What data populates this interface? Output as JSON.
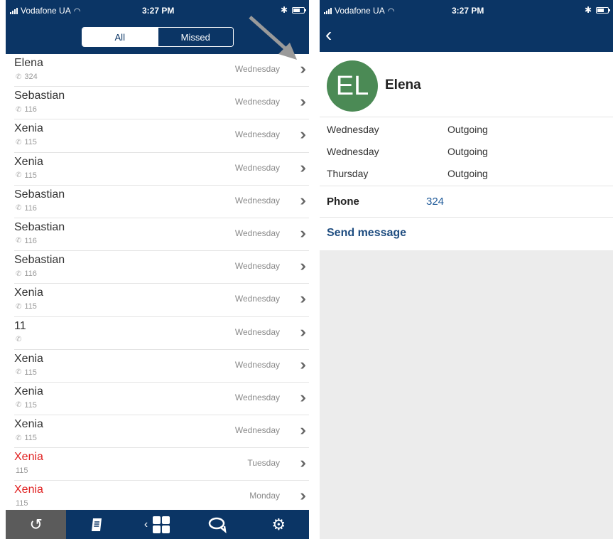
{
  "left": {
    "status": {
      "carrier": "Vodafone UA",
      "time": "3:27 PM"
    },
    "segments": {
      "all": "All",
      "missed": "Missed"
    },
    "calls": [
      {
        "name": "Elena",
        "number": "324",
        "day": "Wednesday",
        "missed": false
      },
      {
        "name": "Sebastian",
        "number": "116",
        "day": "Wednesday",
        "missed": false
      },
      {
        "name": "Xenia",
        "number": "115",
        "day": "Wednesday",
        "missed": false
      },
      {
        "name": "Xenia",
        "number": "115",
        "day": "Wednesday",
        "missed": false
      },
      {
        "name": "Sebastian",
        "number": "116",
        "day": "Wednesday",
        "missed": false
      },
      {
        "name": "Sebastian",
        "number": "116",
        "day": "Wednesday",
        "missed": false
      },
      {
        "name": "Sebastian",
        "number": "116",
        "day": "Wednesday",
        "missed": false
      },
      {
        "name": "Xenia",
        "number": "115",
        "day": "Wednesday",
        "missed": false
      },
      {
        "name": "11",
        "number": "",
        "day": "Wednesday",
        "missed": false
      },
      {
        "name": "Xenia",
        "number": "115",
        "day": "Wednesday",
        "missed": false
      },
      {
        "name": "Xenia",
        "number": "115",
        "day": "Wednesday",
        "missed": false
      },
      {
        "name": "Xenia",
        "number": "115",
        "day": "Wednesday",
        "missed": false
      },
      {
        "name": "Xenia",
        "number": "115",
        "day": "Tuesday",
        "missed": true
      },
      {
        "name": "Xenia",
        "number": "115",
        "day": "Monday",
        "missed": true
      }
    ],
    "tabs": [
      {
        "name": "history-icon",
        "active": true
      },
      {
        "name": "contacts-book-icon",
        "active": false
      },
      {
        "name": "grid-icon",
        "active": false
      },
      {
        "name": "chat-icon",
        "active": false
      },
      {
        "name": "settings-gears-icon",
        "active": false
      }
    ]
  },
  "right": {
    "status": {
      "carrier": "Vodafone UA",
      "time": "3:27 PM"
    },
    "contact": {
      "initials": "EL",
      "name": "Elena",
      "avatar_color": "#4b8a55"
    },
    "history": [
      {
        "day": "Wednesday",
        "type": "Outgoing"
      },
      {
        "day": "Wednesday",
        "type": "Outgoing"
      },
      {
        "day": "Thursday",
        "type": "Outgoing"
      }
    ],
    "phone": {
      "label": "Phone",
      "value": "324"
    },
    "send_message": "Send message"
  },
  "colors": {
    "nav": "#0b3565",
    "missed": "#e02020",
    "link": "#1f5a99"
  }
}
